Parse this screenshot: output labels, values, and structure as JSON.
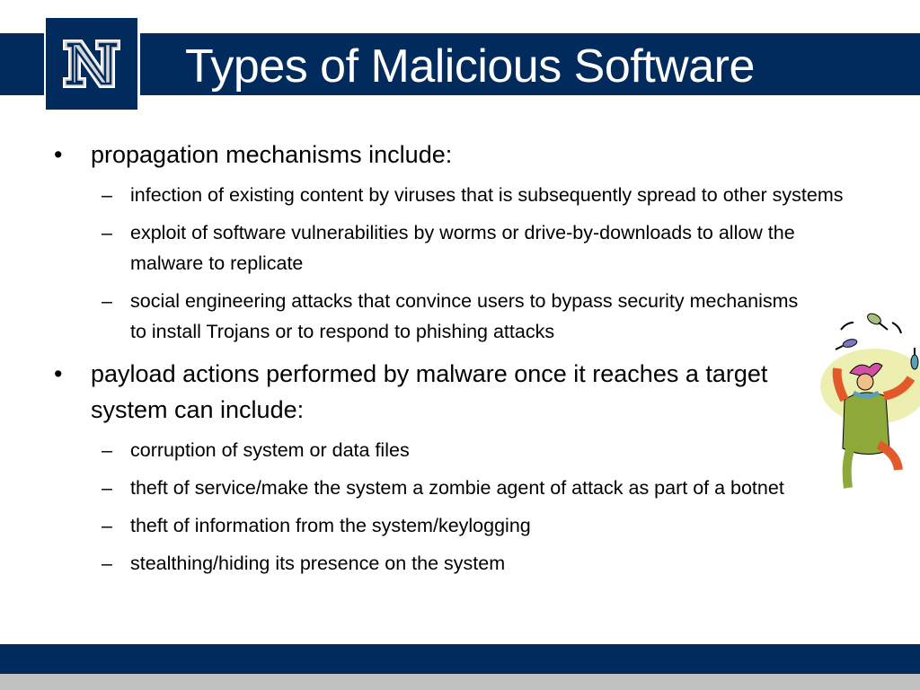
{
  "slide": {
    "title": "Types of Malicious Software",
    "logo_letter": "N",
    "colors": {
      "brand_navy": "#002B5C",
      "footer_gray": "#C0C0C0",
      "logo_letter_fill": "#D4D4D4"
    },
    "sections": [
      {
        "bullet": "•",
        "heading": "propagation mechanisms include:",
        "items": [
          {
            "dash": "–",
            "text": "infection of existing content by viruses that is subsequently spread to other systems"
          },
          {
            "dash": "–",
            "text": "exploit of software vulnerabilities by worms or drive-by-downloads to allow the malware to replicate"
          },
          {
            "dash": "–",
            "text": "social engineering attacks that convince users to bypass security mechanisms to install Trojans or to respond to phishing attacks"
          }
        ]
      },
      {
        "bullet": "•",
        "heading": "payload actions performed by malware once it reaches a target system can include:",
        "items": [
          {
            "dash": "–",
            "text": "corruption of system or data files"
          },
          {
            "dash": "–",
            "text": "theft of service/make the system a zombie agent of attack as part of a botnet"
          },
          {
            "dash": "–",
            "text": "theft of information from the system/keylogging"
          },
          {
            "dash": "–",
            "text": "stealthing/hiding its presence on the system"
          }
        ]
      }
    ],
    "clipart": "juggling-jester-clipart"
  }
}
